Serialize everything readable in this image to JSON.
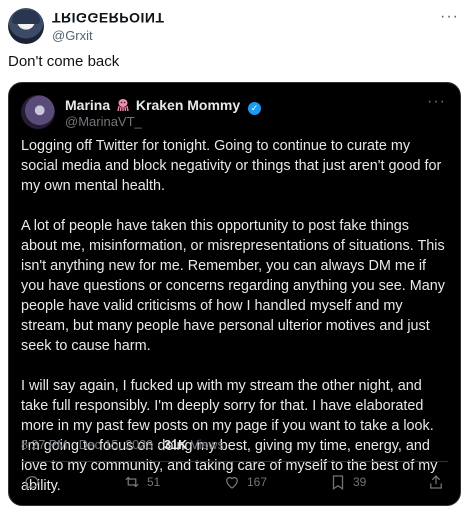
{
  "outer": {
    "name": "TRIGGERPOINT",
    "handle": "@Grxit",
    "more_icon": "more-horizontal-icon",
    "text": "Don't come back"
  },
  "quoted": {
    "name_part1": "Marina",
    "name_emoji": "octopus-icon",
    "name_part2": "Kraken Mommy",
    "handle": "@MarinaVT_",
    "paragraphs": [
      "Logging off Twitter for tonight. Going to continue to curate my social media and block negativity or things that just aren't good for my own mental health.",
      "A lot of people have taken this opportunity to post fake things about me, misinformation, or misrepresentations of situations. This isn't anything new for me. Remember, you can always DM me if you have questions or concerns regarding anything you see. Many people have valid criticisms of how I handled myself and my stream, but many people have personal ulterior motives and just seek to cause harm.",
      "I will say again, I fucked up with my stream the other night, and take full responsibly. I'm deeply sorry for that. I have elaborated more in my past few posts on my page if you want to take a look. I'm going to focus on doing my best, giving my time, energy, and love to my community, and taking care of myself to the best of my ability."
    ],
    "time": "8:27 PM",
    "date": "Dec 15, 2023",
    "views_count": "31K",
    "views_label": "Views",
    "actions": {
      "reply": "",
      "retweets": "51",
      "likes": "167",
      "bookmarks": "39"
    }
  },
  "colors": {
    "accent": "#1d9bf0",
    "card_bg": "#000000",
    "muted": "#71767b"
  }
}
